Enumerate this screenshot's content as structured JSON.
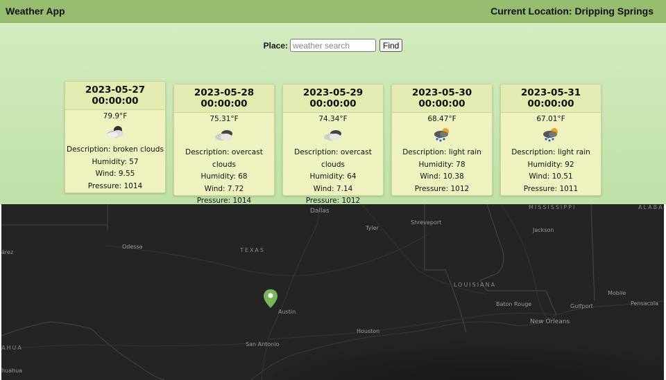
{
  "header": {
    "app_title": "Weather App",
    "location_label": "Current Location: Dripping Springs"
  },
  "search": {
    "label": "Place:",
    "placeholder": "weather search",
    "button_label": "Find"
  },
  "forecast": [
    {
      "date": "2023-05-27",
      "time": "00:00:00",
      "temp": "79.9°F",
      "icon": "broken-clouds-icon",
      "description": "Description: broken clouds",
      "humidity": "Humidity: 57",
      "wind": "Wind: 9.55",
      "pressure": "Pressure: 1014"
    },
    {
      "date": "2023-05-28",
      "time": "00:00:00",
      "temp": "75.31°F",
      "icon": "overcast-clouds-icon",
      "description": "Description: overcast clouds",
      "humidity": "Humidity: 68",
      "wind": "Wind: 7.72",
      "pressure": "Pressure: 1014"
    },
    {
      "date": "2023-05-29",
      "time": "00:00:00",
      "temp": "74.34°F",
      "icon": "overcast-clouds-icon",
      "description": "Description: overcast clouds",
      "humidity": "Humidity: 64",
      "wind": "Wind: 7.14",
      "pressure": "Pressure: 1012"
    },
    {
      "date": "2023-05-30",
      "time": "00:00:00",
      "temp": "68.47°F",
      "icon": "light-rain-icon",
      "description": "Description: light rain",
      "humidity": "Humidity: 78",
      "wind": "Wind: 10.38",
      "pressure": "Pressure: 1012"
    },
    {
      "date": "2023-05-31",
      "time": "00:00:00",
      "temp": "67.01°F",
      "icon": "light-rain-icon",
      "description": "Description: light rain",
      "humidity": "Humidity: 92",
      "wind": "Wind: 10.51",
      "pressure": "Pressure: 1011"
    }
  ],
  "map": {
    "labels": {
      "dallas": "Dallas",
      "shreveport": "Shreveport",
      "tyler": "Tyler",
      "jackson": "Jackson",
      "mississippi": "MISSISSIPPI",
      "alabama": "ALABAM",
      "odessa": "Odessa",
      "texas": "TEXAS",
      "juarez": "árez",
      "louisiana": "LOUISIANA",
      "austin": "Austin",
      "baton_rouge": "Baton Rouge",
      "gulfport": "Gulfport",
      "mobile": "Mobile",
      "pensacola": "Pensacola",
      "new_orleans": "New Orleans",
      "houston": "Houston",
      "san_antonio": "San Antonio",
      "chihuahua_state": "AHUA",
      "chihuahua_city": "huahua"
    },
    "marker_icon": "map-pin-icon",
    "marker_color": "#7ab55c"
  }
}
